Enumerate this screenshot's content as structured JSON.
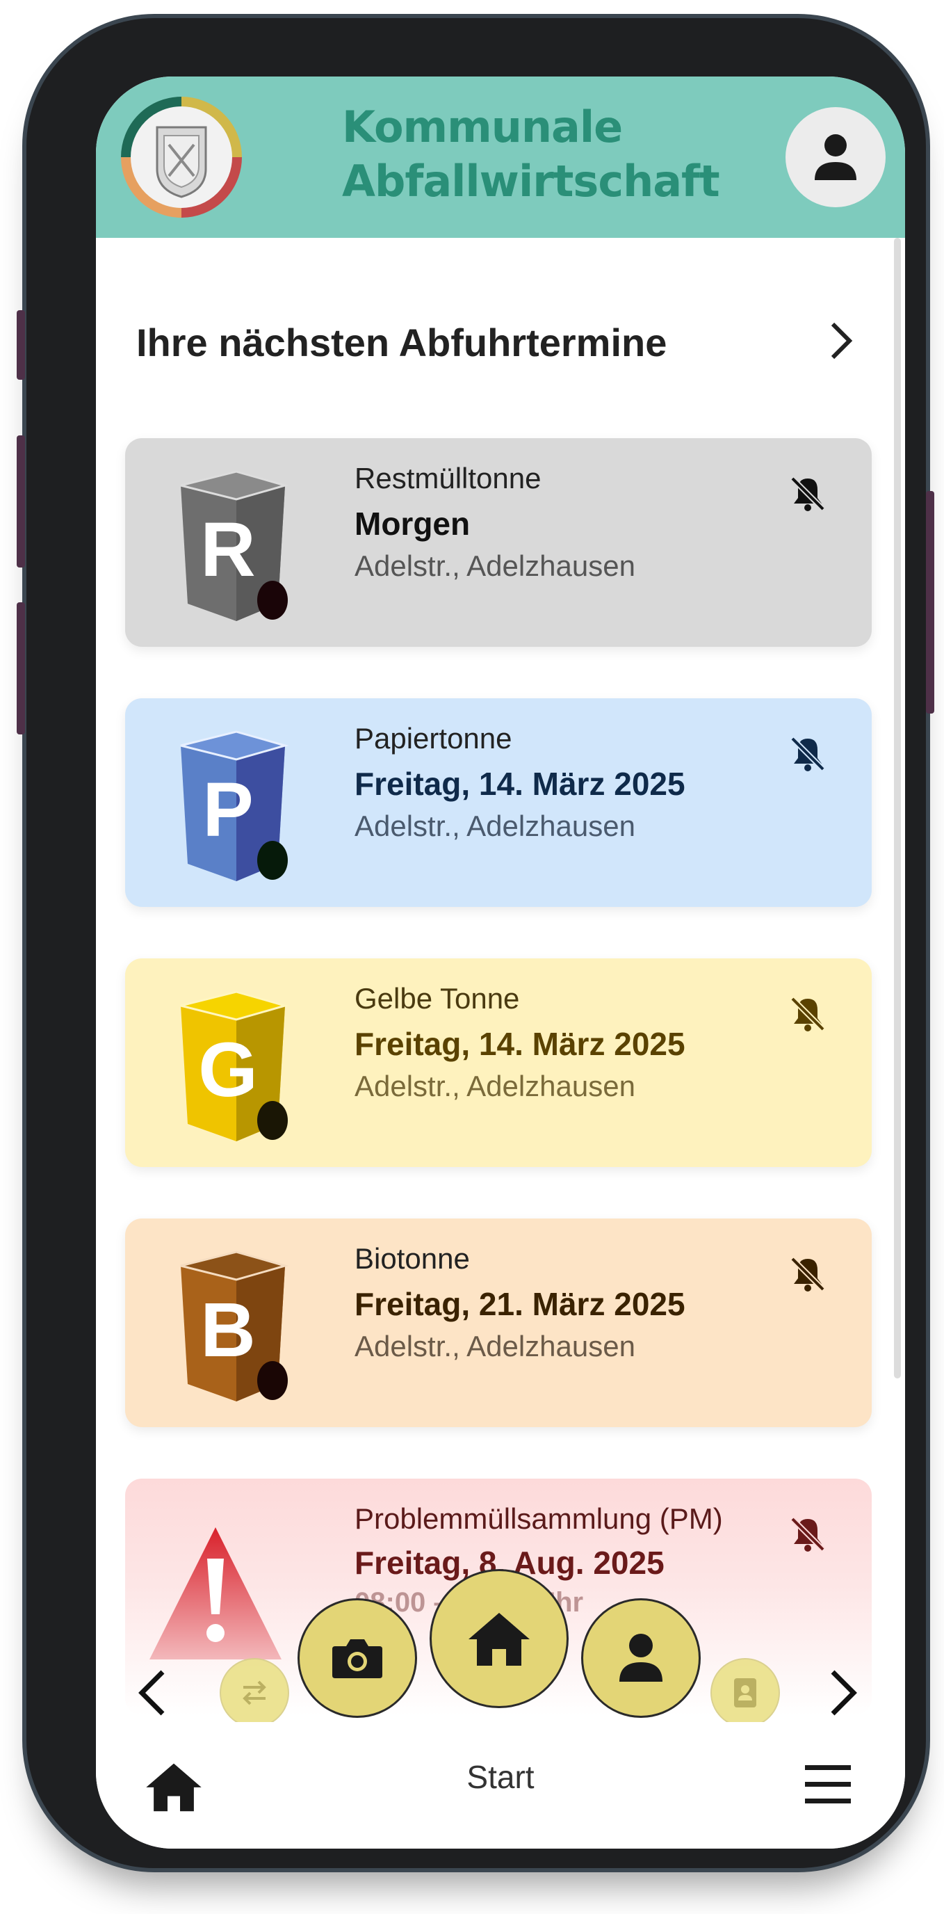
{
  "header": {
    "title_line1": "Kommunale",
    "title_line2": "Abfallwirtschaft",
    "logo_icon": "municipal-crest-logo",
    "profile_icon": "person-icon"
  },
  "section": {
    "title": "Ihre nächsten Abfuhrtermine",
    "chevron_icon": "chevron-right-icon"
  },
  "pickups": [
    {
      "type": "Restmülltonne",
      "date": "Morgen",
      "address": "Adelstr., Adelzhausen",
      "letter": "R",
      "bg": "#d9d9d9",
      "date_color": "#111111",
      "addr_color": "#555555",
      "icon": "bell-off-icon"
    },
    {
      "type": "Papiertonne",
      "date": "Freitag, 14. März 2025",
      "address": "Adelstr., Adelzhausen",
      "letter": "P",
      "bg": "#d1e6fb",
      "date_color": "#0f2a4a",
      "addr_color": "#4a5a6e",
      "icon": "bell-off-icon"
    },
    {
      "type": "Gelbe Tonne",
      "date": "Freitag, 14. März 2025",
      "address": "Adelstr., Adelzhausen",
      "letter": "G",
      "bg": "#fef2be",
      "date_color": "#5a4200",
      "addr_color": "#7a6a3a",
      "icon": "bell-off-icon"
    },
    {
      "type": "Biotonne",
      "date": "Freitag, 21. März 2025",
      "address": "Adelstr., Adelzhausen",
      "letter": "B",
      "bg": "#fde4c6",
      "date_color": "#3a2200",
      "addr_color": "#6b5a48",
      "icon": "bell-off-icon"
    },
    {
      "type": "Problemmüllsammlung (PM)",
      "date": "Freitag, 8. Aug. 2025",
      "time": "08:00 – 12:00 Uhr",
      "bg": "#fddada",
      "date_color": "#6a1a1a",
      "addr_color": "#7a4a4a",
      "icon": "bell-off-icon"
    }
  ],
  "floating_nav": {
    "prev_icon": "chevron-left-icon",
    "next_icon": "chevron-right-icon",
    "items": [
      "swap-icon",
      "camera-icon",
      "home-icon",
      "person-icon",
      "address-book-icon"
    ]
  },
  "bottom_bar": {
    "label": "Start",
    "home_icon": "home-icon",
    "menu_icon": "hamburger-menu-icon"
  },
  "colors": {
    "header_bg": "#7ecbbd",
    "header_text": "#2a8f78",
    "fab_bg": "#e3d576"
  }
}
